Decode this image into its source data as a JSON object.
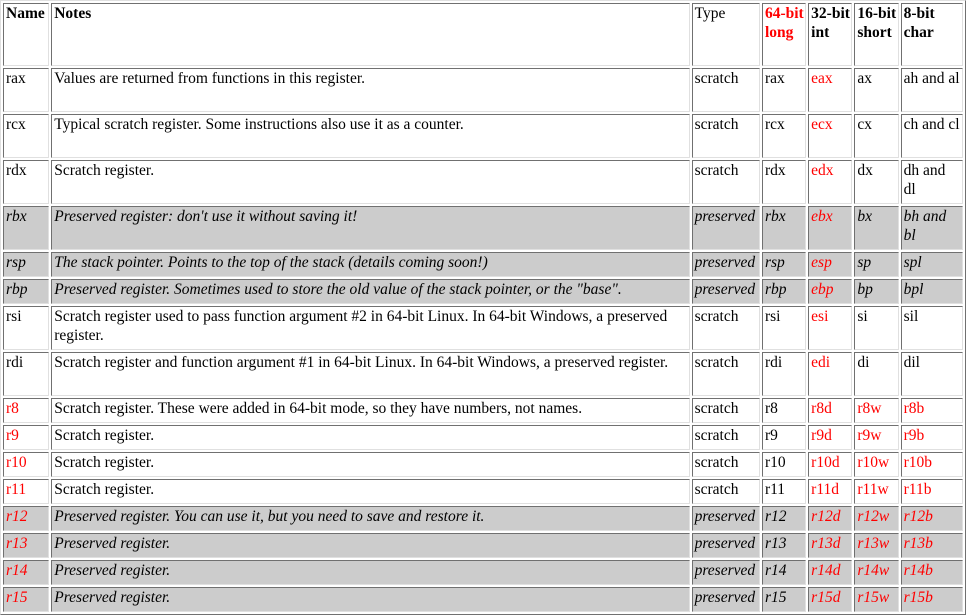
{
  "headers": {
    "name": "Name",
    "notes": "Notes",
    "type": "Type",
    "b64": "64-bit long",
    "b32": "32-bit int",
    "b16": "16-bit short",
    "b8": "8-bit char"
  },
  "colors": {
    "highlight": "#ff0000",
    "preserved_bg": "#cccccc"
  },
  "rows": [
    {
      "name": "rax",
      "notes": "Values are returned from functions in this register.",
      "type": "scratch",
      "r64": "rax",
      "r32": "eax",
      "r16": "ax",
      "r8": "ah and al",
      "preserved": false,
      "tall": true,
      "red": [
        4
      ]
    },
    {
      "name": "rcx",
      "notes": "Typical scratch register.  Some instructions also use it as a counter.",
      "type": "scratch",
      "r64": "rcx",
      "r32": "ecx",
      "r16": "cx",
      "r8": "ch and cl",
      "preserved": false,
      "tall": true,
      "red": [
        4
      ]
    },
    {
      "name": "rdx",
      "notes": "Scratch register.",
      "type": "scratch",
      "r64": "rdx",
      "r32": "edx",
      "r16": "dx",
      "r8": "dh and dl",
      "preserved": false,
      "tall": true,
      "red": [
        4
      ]
    },
    {
      "name": "rbx",
      "notes": "Preserved register: don't use it without saving it!",
      "type": "preserved",
      "r64": "rbx",
      "r32": "ebx",
      "r16": "bx",
      "r8": "bh and bl",
      "preserved": true,
      "tall": true,
      "red": [
        4
      ]
    },
    {
      "name": "rsp",
      "notes": "The stack pointer.  Points to the top of the stack (details coming soon!)",
      "type": "preserved",
      "r64": "rsp",
      "r32": "esp",
      "r16": "sp",
      "r8": "spl",
      "preserved": true,
      "tall": false,
      "red": [
        4,
        7
      ]
    },
    {
      "name": "rbp",
      "notes": "Preserved register.  Sometimes used to store the old value of the stack pointer, or the \"base\".",
      "type": "preserved",
      "r64": "rbp",
      "r32": "ebp",
      "r16": "bp",
      "r8": "bpl",
      "preserved": true,
      "tall": false,
      "red": [
        4,
        7
      ]
    },
    {
      "name": "rsi",
      "notes": "Scratch register used to pass function argument #2 in 64-bit Linux.  In 64-bit Windows, a preserved register.",
      "type": "scratch",
      "r64": "rsi",
      "r32": "esi",
      "r16": "si",
      "r8": "sil",
      "preserved": false,
      "tall": true,
      "red": [
        4,
        7
      ]
    },
    {
      "name": "rdi",
      "notes": "Scratch register and function argument #1 in 64-bit Linux.  In 64-bit Windows, a preserved register.",
      "type": "scratch",
      "r64": "rdi",
      "r32": "edi",
      "r16": "di",
      "r8": "dil",
      "preserved": false,
      "tall": true,
      "red": [
        4,
        7
      ]
    },
    {
      "name": "r8",
      "notes": "Scratch register.  These were added in 64-bit mode, so they have numbers, not names.",
      "type": "scratch",
      "r64": "r8",
      "r32": "r8d",
      "r16": "r8w",
      "r8": "r8b",
      "preserved": false,
      "tall": false,
      "red": [
        0,
        4,
        5,
        6,
        7
      ]
    },
    {
      "name": "r9",
      "notes": "Scratch register.",
      "type": "scratch",
      "r64": "r9",
      "r32": "r9d",
      "r16": "r9w",
      "r8": "r9b",
      "preserved": false,
      "tall": false,
      "red": [
        0,
        4,
        5,
        6,
        7
      ]
    },
    {
      "name": "r10",
      "notes": "Scratch register.",
      "type": "scratch",
      "r64": "r10",
      "r32": "r10d",
      "r16": "r10w",
      "r8": "r10b",
      "preserved": false,
      "tall": false,
      "red": [
        0,
        4,
        5,
        6,
        7
      ]
    },
    {
      "name": "r11",
      "notes": "Scratch register.",
      "type": "scratch",
      "r64": "r11",
      "r32": "r11d",
      "r16": "r11w",
      "r8": "r11b",
      "preserved": false,
      "tall": false,
      "red": [
        0,
        4,
        5,
        6,
        7
      ]
    },
    {
      "name": "r12",
      "notes": "Preserved register.  You can use it, but you need to save and restore it.",
      "type": "preserved",
      "r64": "r12",
      "r32": "r12d",
      "r16": "r12w",
      "r8": "r12b",
      "preserved": true,
      "tall": false,
      "red": [
        0,
        4,
        5,
        6,
        7
      ]
    },
    {
      "name": "r13",
      "notes": "Preserved register.",
      "type": "preserved",
      "r64": "r13",
      "r32": "r13d",
      "r16": "r13w",
      "r8": "r13b",
      "preserved": true,
      "tall": false,
      "red": [
        0,
        4,
        5,
        6,
        7
      ]
    },
    {
      "name": "r14",
      "notes": "Preserved register.",
      "type": "preserved",
      "r64": "r14",
      "r32": "r14d",
      "r16": "r14w",
      "r8": "r14b",
      "preserved": true,
      "tall": false,
      "red": [
        0,
        4,
        5,
        6,
        7
      ]
    },
    {
      "name": "r15",
      "notes": "Preserved register.",
      "type": "preserved",
      "r64": "r15",
      "r32": "r15d",
      "r16": "r15w",
      "r8": "r15b",
      "preserved": true,
      "tall": false,
      "red": [
        0,
        4,
        5,
        6,
        7
      ]
    }
  ]
}
